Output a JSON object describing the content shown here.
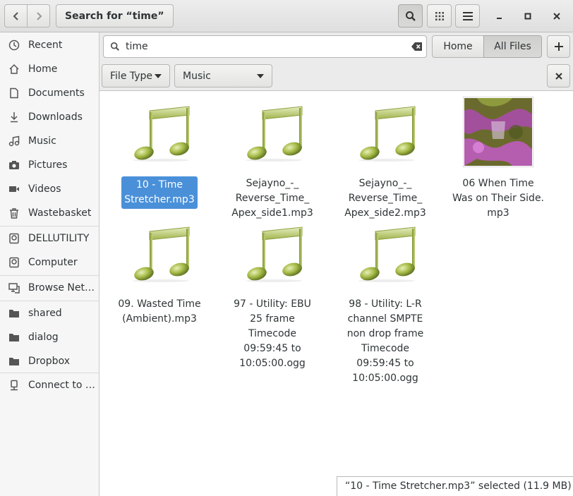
{
  "header": {
    "path_label": "Search for “time”",
    "icons": [
      "back-icon",
      "forward-icon",
      "search-icon",
      "grid-view-icon",
      "menu-icon",
      "minimize-icon",
      "maximize-icon",
      "close-icon"
    ]
  },
  "search": {
    "value": "time",
    "location_buttons": [
      "Home",
      "All Files"
    ],
    "selected_location": "All Files",
    "filter_type_label": "File Type",
    "filter_value": "Music"
  },
  "sidebar": {
    "items": [
      {
        "label": "Recent",
        "icon": "recent-icon"
      },
      {
        "label": "Home",
        "icon": "home-icon"
      },
      {
        "label": "Documents",
        "icon": "documents-icon"
      },
      {
        "label": "Downloads",
        "icon": "downloads-icon"
      },
      {
        "label": "Music",
        "icon": "music-icon"
      },
      {
        "label": "Pictures",
        "icon": "pictures-icon"
      },
      {
        "label": "Videos",
        "icon": "videos-icon"
      },
      {
        "label": "Wastebasket",
        "icon": "trash-icon"
      },
      {
        "label": "DELLUTILITY",
        "icon": "drive-icon"
      },
      {
        "label": "Computer",
        "icon": "computer-icon"
      },
      {
        "label": "Browse Net…",
        "icon": "network-icon"
      },
      {
        "label": "shared",
        "icon": "folder-icon"
      },
      {
        "label": "dialog",
        "icon": "folder-icon"
      },
      {
        "label": "Dropbox",
        "icon": "folder-icon"
      },
      {
        "label": "Connect to …",
        "icon": "connect-icon"
      }
    ]
  },
  "files": [
    {
      "name": "10 - Time Stretcher.mp3",
      "lines": [
        "10 - Time",
        "Stretcher.mp3"
      ],
      "icon": "music-note-icon",
      "selected": true
    },
    {
      "name": "Sejayno_-_Reverse_Time_Apex_side1.mp3",
      "lines": [
        "Sejayno_-_",
        "Reverse_Time_",
        "Apex_side1.mp3"
      ],
      "icon": "music-note-icon"
    },
    {
      "name": "Sejayno_-_Reverse_Time_Apex_side2.mp3",
      "lines": [
        "Sejayno_-_",
        "Reverse_Time_",
        "Apex_side2.mp3"
      ],
      "icon": "music-note-icon"
    },
    {
      "name": "06 When Time Was on Their Side.mp3",
      "lines": [
        "06 When Time",
        "Was on Their Side.",
        "mp3"
      ],
      "icon": "album-art-thumbnail"
    },
    {
      "name": "09. Wasted Time (Ambient).mp3",
      "lines": [
        "09. Wasted Time",
        "(Ambient).mp3"
      ],
      "icon": "music-note-icon"
    },
    {
      "name": "97 - Utility: EBU 25 frame Timecode 09:59:45 to 10:05:00.ogg",
      "lines": [
        "97 - Utility: EBU",
        "25 frame",
        "Timecode",
        "09:59:45 to",
        "10:05:00.ogg"
      ],
      "icon": "music-note-icon"
    },
    {
      "name": "98 - Utility: L-R channel SMPTE non drop frame Timecode 09:59:45 to 10:05:00.ogg",
      "lines": [
        "98 - Utility: L-R",
        "channel SMPTE",
        "non drop frame",
        "Timecode",
        "09:59:45 to",
        "10:05:00.ogg"
      ],
      "icon": "music-note-icon"
    }
  ],
  "status": {
    "text": "“10 - Time Stretcher.mp3” selected  (11.9 MB)"
  },
  "colors": {
    "selection": "#4a90d9",
    "note_green": "#9fb34a"
  }
}
